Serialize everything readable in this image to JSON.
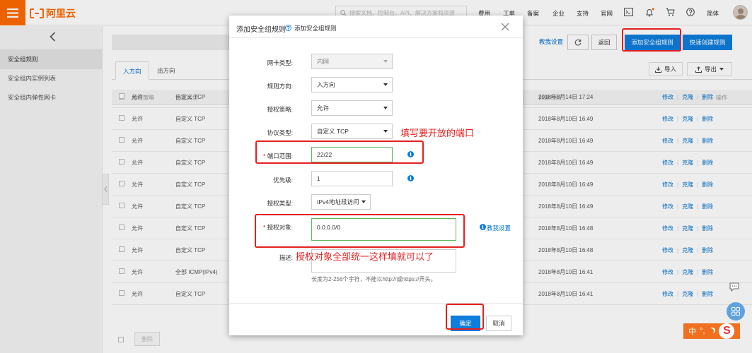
{
  "topbar": {
    "logo_text": "阿里云",
    "search_placeholder": "搜索文档、控制台、API、解决方案和资源",
    "nav": [
      "费用",
      "工单",
      "备案",
      "企业",
      "支持",
      "官网"
    ],
    "language": "简体",
    "icons": [
      "menu-icon",
      "search-icon",
      "terminal-icon",
      "bell-icon",
      "cart-icon",
      "help-icon",
      "avatar"
    ]
  },
  "sidebar": {
    "items": [
      "安全组规则",
      "安全组内实例列表",
      "安全组内弹性网卡"
    ]
  },
  "header": {
    "tutorial_link": "教我设置",
    "back_button": "返回",
    "add_rule_button": "添加安全组规则",
    "quick_create_button": "快速创建规则"
  },
  "tabs": [
    "入方向",
    "出方向"
  ],
  "toolbar": {
    "import_label": "导入",
    "export_label": "导出"
  },
  "table": {
    "columns": {
      "policy": "授权策略",
      "protocol": "协议类型",
      "created": "创建时间",
      "actions": "操作"
    },
    "action_labels": [
      "修改",
      "克隆",
      "删除"
    ],
    "rows": [
      {
        "policy": "允许",
        "protocol": "自定义 TCP",
        "created": "2018年8月14日 17:24"
      },
      {
        "policy": "允许",
        "protocol": "自定义 TCP",
        "created": "2018年8月10日 16:49"
      },
      {
        "policy": "允许",
        "protocol": "自定义 TCP",
        "created": "2018年8月10日 16:49"
      },
      {
        "policy": "允许",
        "protocol": "自定义 TCP",
        "created": "2018年8月10日 16:49"
      },
      {
        "policy": "允许",
        "protocol": "自定义 TCP",
        "created": "2018年8月10日 16:49"
      },
      {
        "policy": "允许",
        "protocol": "自定义 TCP",
        "created": "2018年8月10日 16:49"
      },
      {
        "policy": "允许",
        "protocol": "自定义 TCP",
        "created": "2018年8月10日 16:48"
      },
      {
        "policy": "允许",
        "protocol": "自定义 TCP",
        "created": "2018年8月10日 16:48"
      },
      {
        "policy": "允许",
        "protocol": "全部 ICMP(IPv4)",
        "created": "2018年8月10日 16:41"
      },
      {
        "policy": "允许",
        "protocol": "自定义 TCP",
        "created": "2018年8月10日 16:41"
      }
    ],
    "delete_button": "删除"
  },
  "dialog": {
    "title": "添加安全组规则",
    "subtitle": "添加安全组规则",
    "fields": {
      "nic_type_label": "网卡类型:",
      "nic_type_value": "内网",
      "direction_label": "规则方向:",
      "direction_value": "入方向",
      "policy_label": "授权策略:",
      "policy_value": "允许",
      "protocol_label": "协议类型:",
      "protocol_value": "自定义 TCP",
      "port_required": "*",
      "port_label": "端口范围:",
      "port_value": "22/22",
      "priority_label": "优先级:",
      "priority_value": "1",
      "auth_type_label": "授权类型:",
      "auth_type_value": "IPv4地址段访问",
      "auth_object_required": "*",
      "auth_object_label": "授权对象:",
      "auth_object_value": "0.0.0.0/0",
      "desc_label": "描述:",
      "desc_hint": "长度为2-256个字符，不能以http://或https://开头。"
    },
    "tutorial_link": "教我设置",
    "ok_button": "确定",
    "cancel_button": "取消"
  },
  "annotations": {
    "port_note": "填写要开放的端口",
    "auth_note": "授权对象全部统一这样填就可以了",
    "color": "#e52020"
  },
  "ime": {
    "label": "中",
    "glyph": "°,",
    "brand": "S"
  },
  "colors": {
    "brand_orange": "#ff6a00",
    "primary_blue": "#0f7ddc",
    "link_blue": "#0070cc"
  }
}
